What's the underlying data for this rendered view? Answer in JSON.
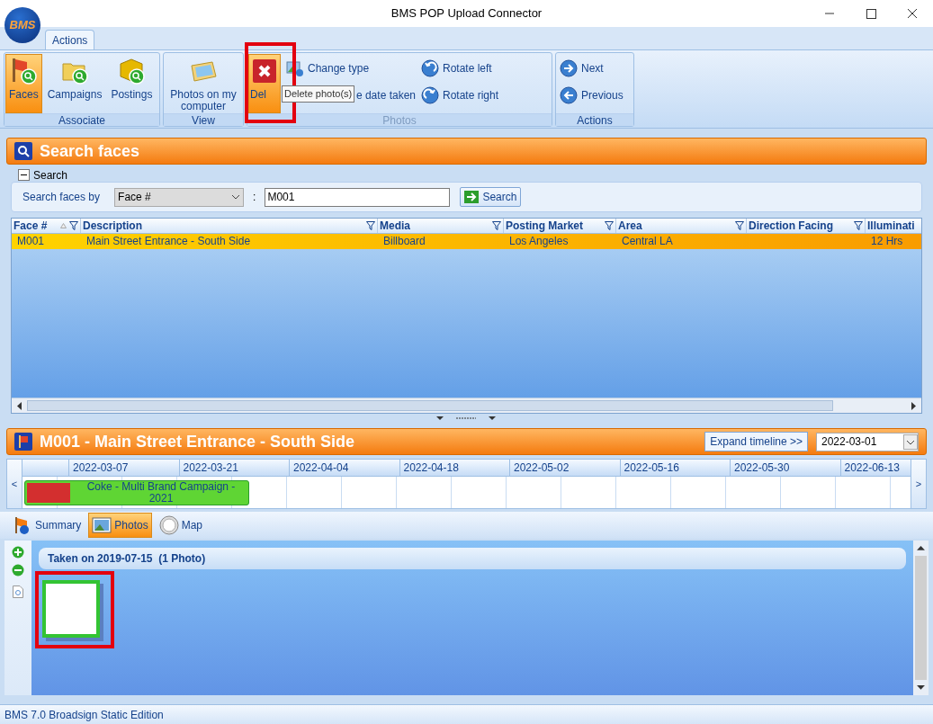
{
  "window": {
    "title": "BMS POP Upload Connector",
    "logo": "BMS"
  },
  "ribbon_tabs": [
    {
      "label": "Actions",
      "selected": true
    }
  ],
  "ribbon_groups": [
    {
      "label": "Associate",
      "disabled": false,
      "buttons": [
        {
          "label": "Faces",
          "selected": true
        },
        {
          "label": "Campaigns",
          "selected": false
        },
        {
          "label": "Postings",
          "selected": false
        }
      ]
    },
    {
      "label": "View",
      "disabled": false,
      "buttons": [
        {
          "label": "Photos on my computer",
          "selected": false
        }
      ]
    },
    {
      "label": "Photos",
      "disabled": true,
      "buttons": [
        {
          "label": "Del",
          "selected": true
        }
      ],
      "small_buttons": [
        {
          "label": "Change type",
          "covered": false
        },
        {
          "label": "e date taken",
          "covered": true
        },
        {
          "label": "Rotate left",
          "covered": false
        },
        {
          "label": "Rotate right",
          "covered": false
        }
      ]
    },
    {
      "label": "Actions",
      "disabled": false,
      "small_buttons": [
        {
          "label": "Next",
          "covered": false
        },
        {
          "label": "Previous",
          "covered": false
        }
      ]
    }
  ],
  "tooltip": "Delete photo(s)",
  "search_panel": {
    "title": "Search faces",
    "group_label": "Search",
    "expanded": true,
    "field_label": "Search faces by",
    "select_value": "Face #",
    "separator": ":",
    "query": "M001",
    "button": "Search"
  },
  "table": {
    "columns": [
      {
        "label": "Face #",
        "sorted": true
      },
      {
        "label": "Description",
        "sorted": false
      },
      {
        "label": "Media",
        "sorted": false
      },
      {
        "label": "Posting Market",
        "sorted": false
      },
      {
        "label": "Area",
        "sorted": false
      },
      {
        "label": "Direction Facing",
        "sorted": false
      },
      {
        "label": "Illuminati",
        "sorted": false
      }
    ],
    "rows": [
      {
        "selected": true,
        "cells": [
          "M001",
          "Main Street Entrance - South Side",
          "Billboard",
          "Los Angeles",
          "Central LA",
          "",
          "12 Hrs"
        ]
      }
    ]
  },
  "detail": {
    "title": "M001 - Main Street Entrance - South Side",
    "expand_button": "Expand timeline >>",
    "date": "2022-03-01",
    "timeline": {
      "prev": "<",
      "next": ">",
      "dates": [
        "2022-03-07",
        "2022-03-21",
        "2022-04-04",
        "2022-04-18",
        "2022-05-02",
        "2022-05-16",
        "2022-05-30",
        "2022-06-13"
      ],
      "campaigns": [
        {
          "label": "Coke - Multi Brand Campaign - 2021",
          "color": "#5fd534"
        }
      ]
    }
  },
  "detail_tabs": [
    {
      "label": "Summary",
      "selected": false
    },
    {
      "label": "Photos",
      "selected": true
    },
    {
      "label": "Map",
      "selected": false
    }
  ],
  "photo_groups": [
    {
      "header": "Taken on 2019-07-15  (1 Photo)",
      "photos": [
        {
          "selected": true
        }
      ]
    }
  ],
  "status_bar": "BMS 7.0 Broadsign Static Edition"
}
